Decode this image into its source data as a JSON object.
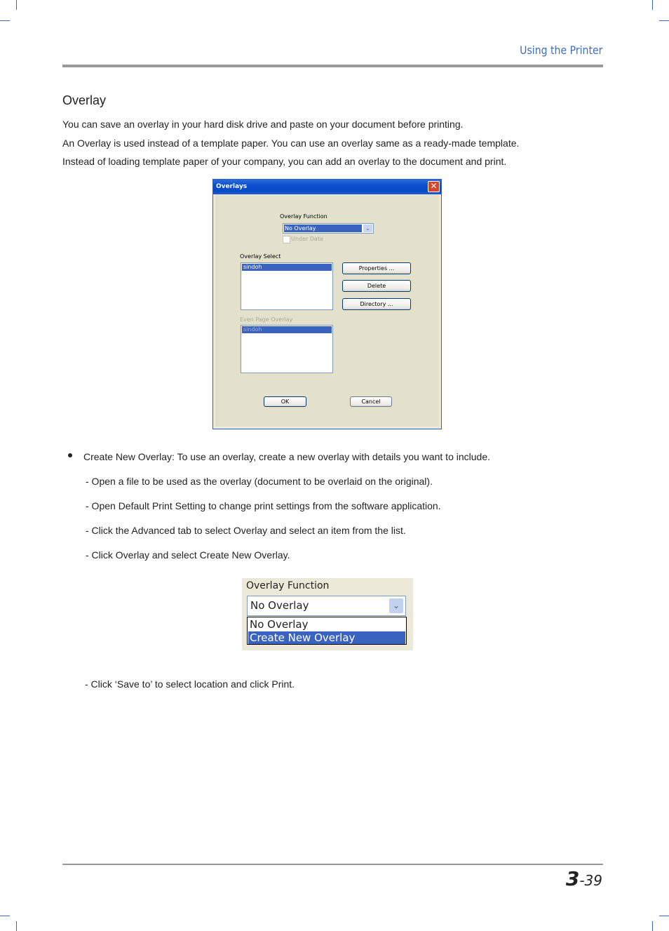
{
  "header": {
    "title": "Using the Printer"
  },
  "section": {
    "title": "Overlay",
    "paragraphs": [
      "You can save an overlay in your hard disk drive and paste on your document before printing.",
      "An Overlay is used instead of a template paper. You can use an overlay same as a ready-made template.",
      "Instead of loading template paper of your company, you can add an overlay to the document and print."
    ]
  },
  "dialog": {
    "title": "Overlays",
    "close_icon": "close-icon",
    "overlay_function_label": "Overlay Function",
    "overlay_function_value": "No Overlay",
    "under_data_label": "Under Data",
    "under_data_checked": false,
    "overlay_select_label": "Overlay Select",
    "overlay_select_items": [
      "sindoh"
    ],
    "even_page_overlay_label": "Even Page Overlay",
    "even_page_overlay_items": [
      "sindoh"
    ],
    "buttons": {
      "properties": "Properties ...",
      "delete": "Delete",
      "directory": "Directory ...",
      "ok": "OK",
      "cancel": "Cancel"
    }
  },
  "steps": {
    "bullet": "Create New Overlay: To use an overlay, create a new overlay with details you want to include.",
    "substeps": [
      "-  Open a file to be used as the overlay (document to be overlaid on the original).",
      "-  Open Default Print Setting to change print settings from the software application.",
      "-  Click the Advanced tab to select Overlay and select an item from the list.",
      "-  Click Overlay and select Create New Overlay."
    ],
    "final_step": "-  Click ‘Save to’ to select location and click Print."
  },
  "dropdown_figure": {
    "label": "Overlay Function",
    "value": "No Overlay",
    "options": [
      "No Overlay",
      "Create New Overlay"
    ],
    "selected_option": "Create New Overlay"
  },
  "footer": {
    "chapter": "3",
    "page": "-39"
  }
}
